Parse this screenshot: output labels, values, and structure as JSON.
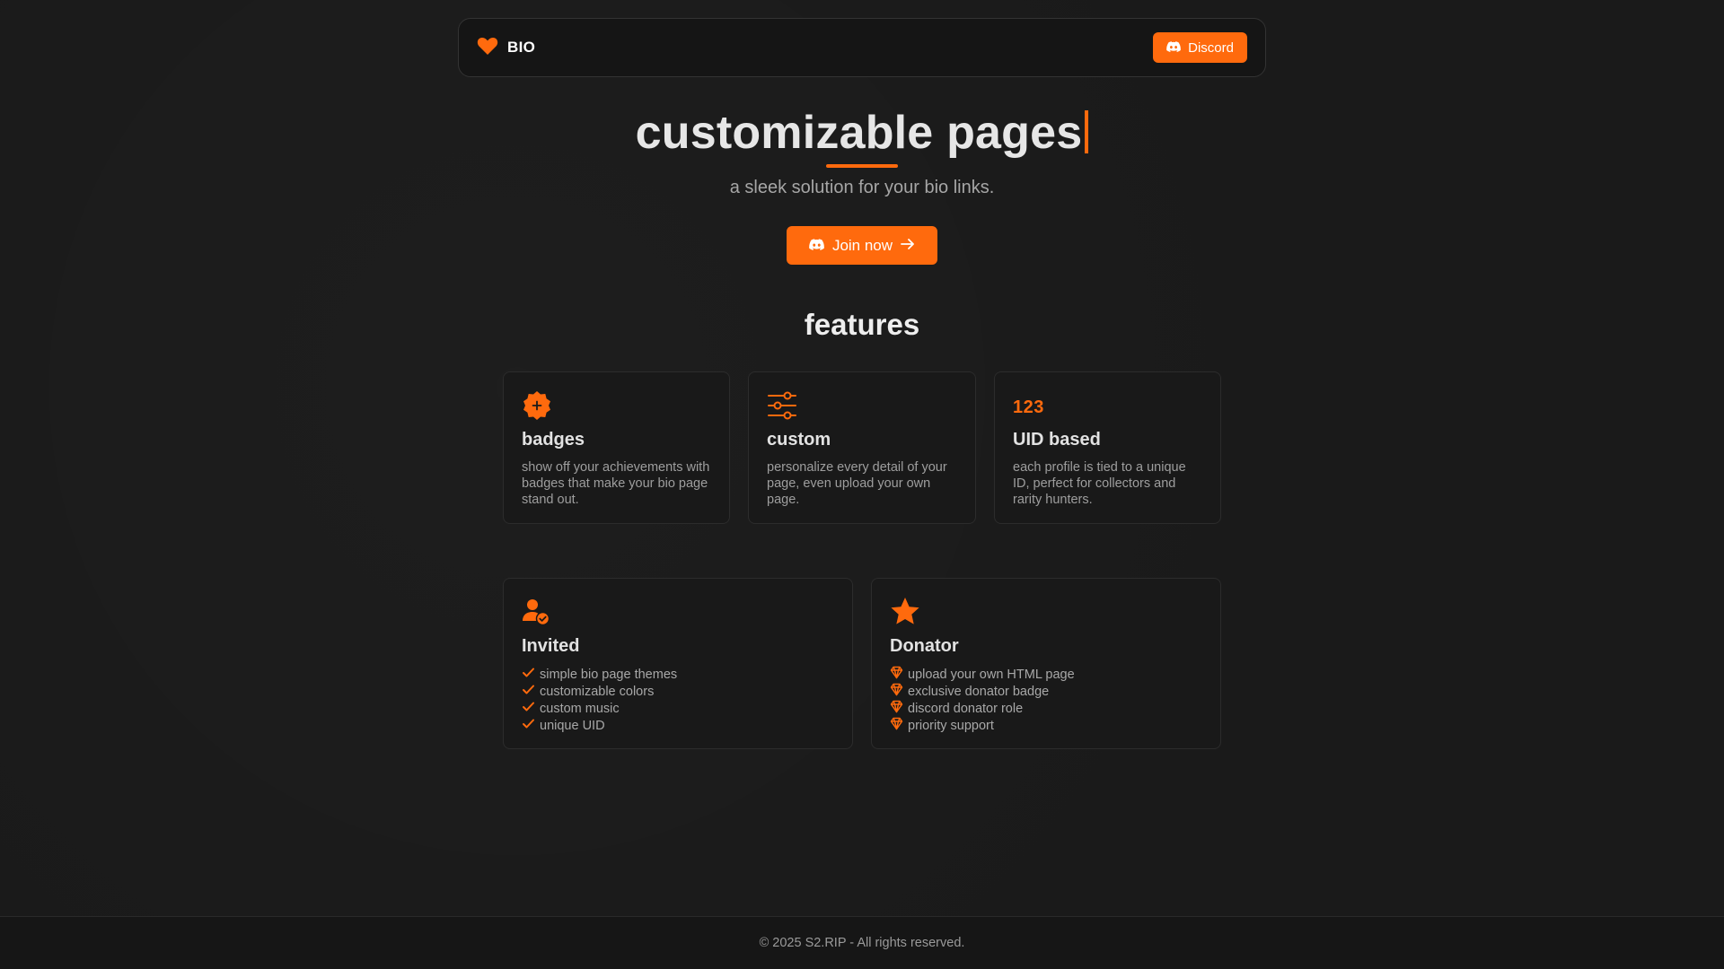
{
  "colors": {
    "accent": "#ff6a0d",
    "background": "#1a1a1a",
    "card_border": "#2c2c2c"
  },
  "nav": {
    "brand": {
      "icon": "heart-icon",
      "label": "BIO"
    },
    "discord_button": {
      "icon": "discord-icon",
      "label": "Discord"
    }
  },
  "hero": {
    "title": "customizable pages",
    "subtitle": "a sleek solution for your bio links.",
    "join_button": {
      "icon": "discord-icon",
      "label": "Join now",
      "trailing_icon": "arrow-right-icon"
    }
  },
  "features": {
    "title": "features",
    "cards": [
      {
        "icon": "badge-plus-icon",
        "title": "badges",
        "description": "show off your achievements with badges that make your bio page stand out."
      },
      {
        "icon": "sliders-icon",
        "title": "custom",
        "description": "personalize every detail of your page, even upload your own page."
      },
      {
        "icon_text": "123",
        "title": "UID based",
        "description": "each profile is tied to a unique ID, perfect for collectors and rarity hunters."
      }
    ],
    "tiers": [
      {
        "icon": "user-check-icon",
        "title": "Invited",
        "item_icon": "check-icon",
        "items": [
          "simple bio page themes",
          "customizable colors",
          "custom music",
          "unique UID"
        ]
      },
      {
        "icon": "star-icon",
        "title": "Donator",
        "item_icon": "gem-icon",
        "items": [
          "upload your own HTML page",
          "exclusive donator badge",
          "discord donator role",
          "priority support"
        ]
      }
    ]
  },
  "footer": {
    "text": "© 2025 S2.RIP - All rights reserved."
  }
}
